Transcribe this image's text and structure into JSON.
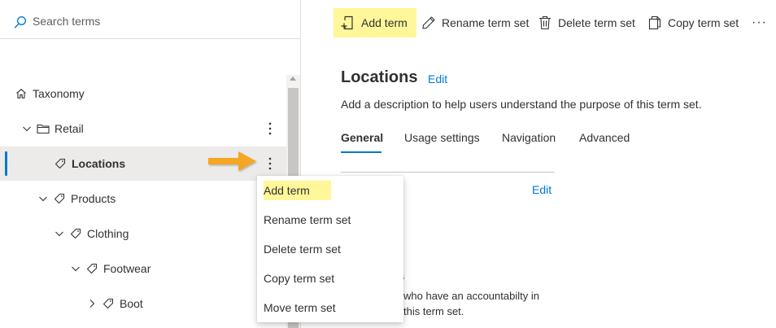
{
  "search": {
    "placeholder": "Search terms"
  },
  "tree": {
    "items": [
      {
        "label": "Taxonomy",
        "icon": "home-icon"
      },
      {
        "label": "Retail",
        "icon": "folder-icon"
      },
      {
        "label": "Locations",
        "icon": "tag-icon"
      },
      {
        "label": "Products",
        "icon": "tag-icon"
      },
      {
        "label": "Clothing",
        "icon": "tag-icon"
      },
      {
        "label": "Footwear",
        "icon": "tag-icon"
      },
      {
        "label": "Boot",
        "icon": "tag-icon"
      }
    ]
  },
  "context_menu": {
    "items": [
      {
        "label": "Add term"
      },
      {
        "label": "Rename term set"
      },
      {
        "label": "Delete term set"
      },
      {
        "label": "Copy term set"
      },
      {
        "label": "Move term set"
      }
    ]
  },
  "toolbar": {
    "add_term": "Add term",
    "rename": "Rename term set",
    "delete": "Delete term set",
    "copy": "Copy term set",
    "more": "···"
  },
  "main": {
    "title": "Locations",
    "title_edit": "Edit",
    "description": "Add a description to help users understand the purpose of this term set.",
    "tabs": [
      {
        "label": "General"
      },
      {
        "label": "Usage settings"
      },
      {
        "label": "Navigation"
      },
      {
        "label": "Advanced"
      }
    ],
    "section_edit": "Edit",
    "partial_heading": "s",
    "partial_line1": "who have an accountabilty in",
    "partial_line2": "this term set."
  },
  "colors": {
    "accent": "#0078d4",
    "highlight": "#fff799",
    "arrow": "#f5a623",
    "selected_row": "#edebe9"
  }
}
